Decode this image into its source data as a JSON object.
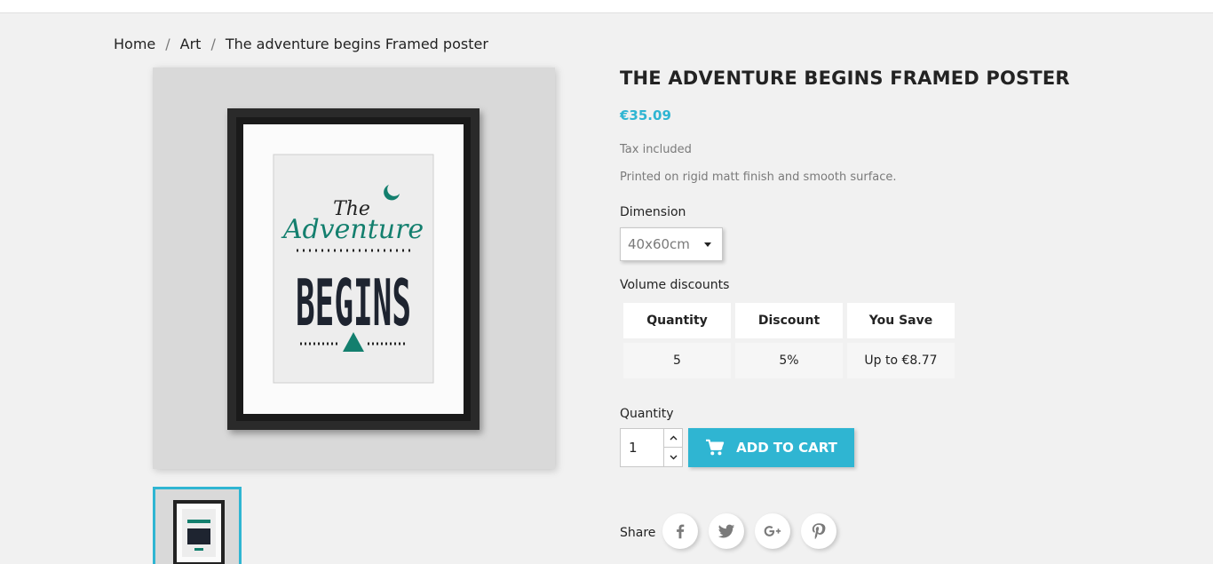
{
  "breadcrumb": {
    "items": [
      "Home",
      "Art",
      "The adventure begins Framed poster"
    ],
    "separator": "/"
  },
  "product": {
    "title": "THE ADVENTURE BEGINS FRAMED POSTER",
    "price": "€35.09",
    "tax_note": "Tax included",
    "description": "Printed on rigid matt finish and smooth surface.",
    "poster_text": {
      "line1": "The",
      "line2": "Adventure",
      "line3": "BEGINS"
    }
  },
  "dimension": {
    "label": "Dimension",
    "selected": "40x60cm"
  },
  "volume_discounts": {
    "label": "Volume discounts",
    "headers": [
      "Quantity",
      "Discount",
      "You Save"
    ],
    "rows": [
      [
        "5",
        "5%",
        "Up to €8.77"
      ]
    ]
  },
  "quantity": {
    "label": "Quantity",
    "value": "1"
  },
  "add_to_cart": {
    "label": "ADD TO CART"
  },
  "share": {
    "label": "Share",
    "networks": [
      "facebook-icon",
      "twitter-icon",
      "google-plus-icon",
      "pinterest-icon"
    ]
  },
  "colors": {
    "accent": "#2fb5d2",
    "text": "#232323",
    "muted": "#7a7a7a",
    "background": "#f1f1f1",
    "poster_teal": "#137f6e"
  }
}
